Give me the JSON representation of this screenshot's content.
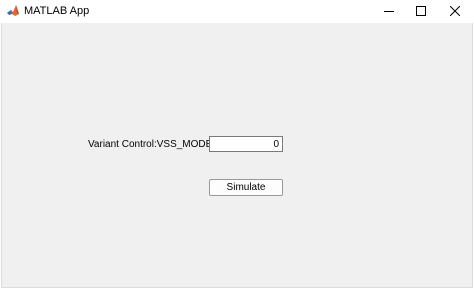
{
  "window": {
    "title": "MATLAB App",
    "icon": "matlab-logo-icon",
    "controls": {
      "minimize_icon": "minimize-icon",
      "maximize_icon": "maximize-icon",
      "close_icon": "close-icon"
    }
  },
  "form": {
    "variant_label": "Variant Control:VSS_MODE",
    "variant_value": "0",
    "simulate_label": "Simulate"
  },
  "colors": {
    "client_background": "#f0f0f0",
    "titlebar_background": "#ffffff",
    "logo_orange": "#e16737",
    "logo_blue": "#2f6fb5"
  }
}
